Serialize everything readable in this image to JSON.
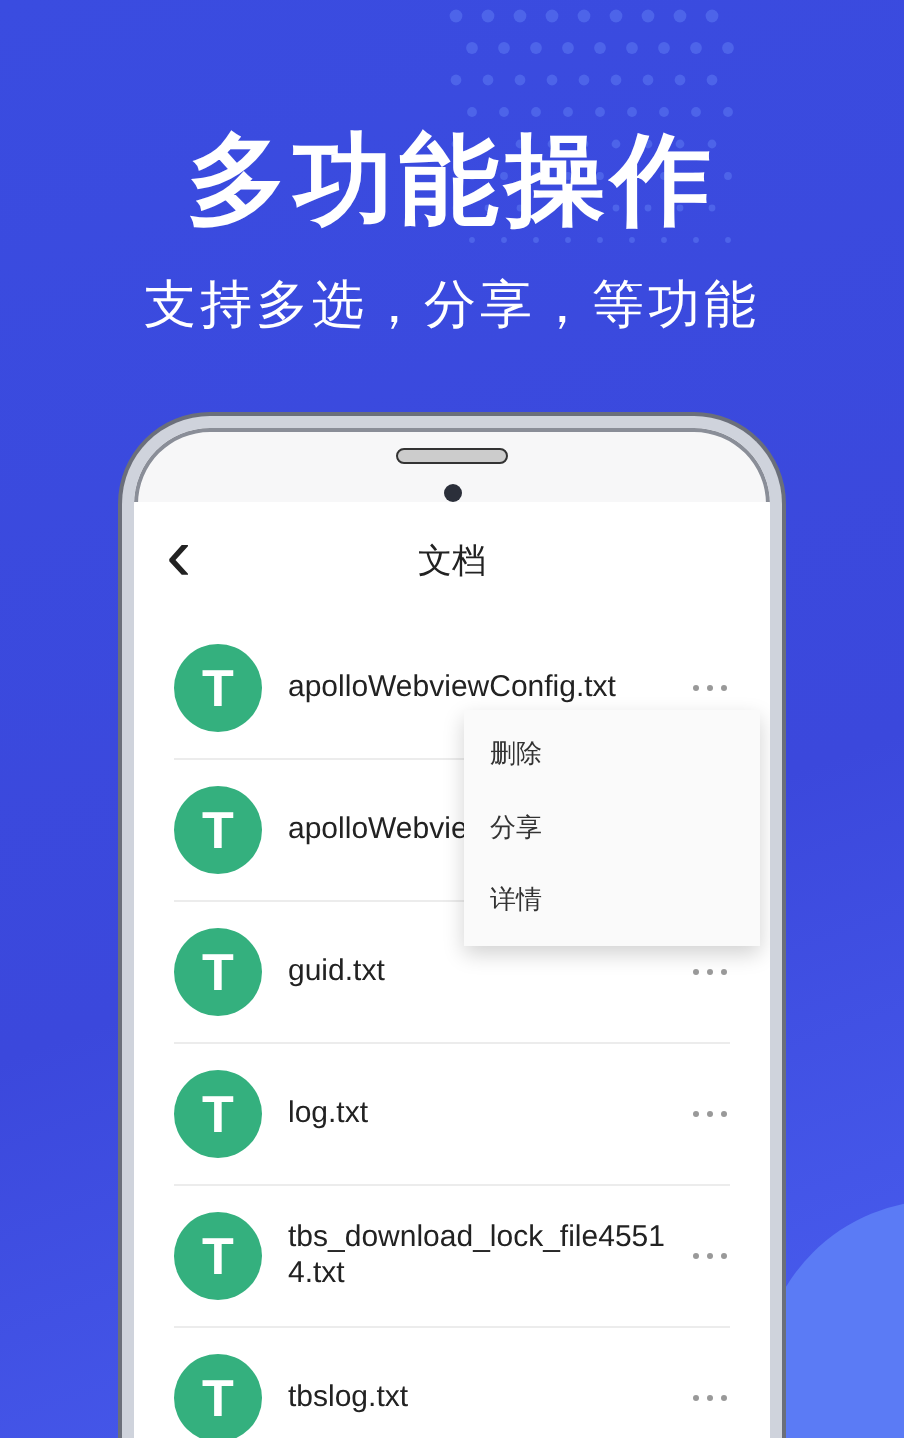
{
  "headline": "多功能操作",
  "subtitle": "支持多选，分享，等功能",
  "screen": {
    "back_icon": "‹",
    "title": "文档",
    "files": [
      {
        "icon_letter": "T",
        "name": "apolloWebviewConfig.txt",
        "more_button": true
      },
      {
        "icon_letter": "T",
        "name": "apolloWebvie",
        "more_button": false
      },
      {
        "icon_letter": "T",
        "name": "guid.txt",
        "more_button": true
      },
      {
        "icon_letter": "T",
        "name": "log.txt",
        "more_button": true
      },
      {
        "icon_letter": "T",
        "name": "tbs_download_lock_file45514.txt",
        "more_button": true
      },
      {
        "icon_letter": "T",
        "name": "tbslog.txt",
        "more_button": true
      }
    ],
    "popup_menu": {
      "items": [
        "删除",
        "分享",
        "详情"
      ]
    }
  }
}
